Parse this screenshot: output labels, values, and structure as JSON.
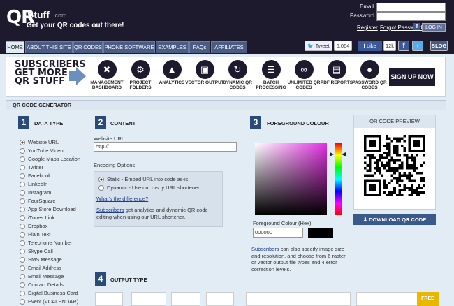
{
  "header": {
    "logo_qr": "QR",
    "logo_stuff": "Stuff",
    "logo_com": ".com",
    "tagline": "Get your QR codes out there!",
    "email_label": "Email",
    "password_label": "Password",
    "register": "Register",
    "forgot": "Forgot Password?",
    "login": "LOG IN"
  },
  "nav": {
    "tabs": [
      "HOME",
      "ABOUT THIS SITE",
      "QR CODES",
      "PHONE SOFTWARE",
      "EXAMPLES",
      "FAQs",
      "AFFILIATES"
    ]
  },
  "social": {
    "tweet": "Tweet",
    "tweet_count": "6,064",
    "like": "Like",
    "like_count": "12k",
    "blog": "BLOG"
  },
  "banner": {
    "headline": "SUBSCRIBERS GET MORE QR STUFF",
    "features": [
      "MANAGEMENT DASHBOARD",
      "PROJECT FOLDERS",
      "ANALYTICS",
      "VECTOR OUTPUT",
      "DYNAMIC QR CODES",
      "BATCH PROCESSING",
      "UNLIMITED QR CODES",
      "PDF REPORTS",
      "PASSWORD QR CODES"
    ],
    "signup": "SIGN UP NOW"
  },
  "generator": {
    "title": "QR CODE GENERATOR"
  },
  "data_type": {
    "number": "1",
    "title": "DATA TYPE",
    "items": [
      "Website URL",
      "YouTube Video",
      "Google Maps Location",
      "Twitter",
      "Facebook",
      "LinkedIn",
      "Instagram",
      "FourSquare",
      "App Store Download",
      "iTunes Link",
      "Dropbox",
      "Plain Text",
      "Telephone Number",
      "Skype Call",
      "SMS Message",
      "Email Address",
      "Email Message",
      "Contact Details",
      "Digital Business Card",
      "Event (VCALENDAR)"
    ],
    "selected": "Website URL"
  },
  "content": {
    "number": "2",
    "title": "CONTENT",
    "url_label": "Website URL",
    "url_value": "http://",
    "encoding_title": "Encoding Options",
    "static_option": "Static - Embed URL into code as-is",
    "dynamic_option": "Dynamic - Use our qrs.ly URL shortener",
    "difference_link": "What's the difference?",
    "subscribers_link": "Subscribers",
    "subscribers_text": " get analytics and dynamic QR code editing when using our URL shortener."
  },
  "foreground": {
    "number": "3",
    "title": "FOREGROUND COLOUR",
    "hex_label": "Foreground Colour (Hex):",
    "hex_value": "000000",
    "hex_color": "#000000",
    "subscribers_link": "Subscribers",
    "note_text": " can also specify image size and resolution, and choose from 6 raster or vector output file types and 4 error correction levels."
  },
  "preview": {
    "title": "QR CODE PREVIEW",
    "download": "DOWNLOAD QR CODE"
  },
  "output": {
    "number": "4",
    "title": "OUTPUT TYPE",
    "free_badge": "FREE"
  }
}
